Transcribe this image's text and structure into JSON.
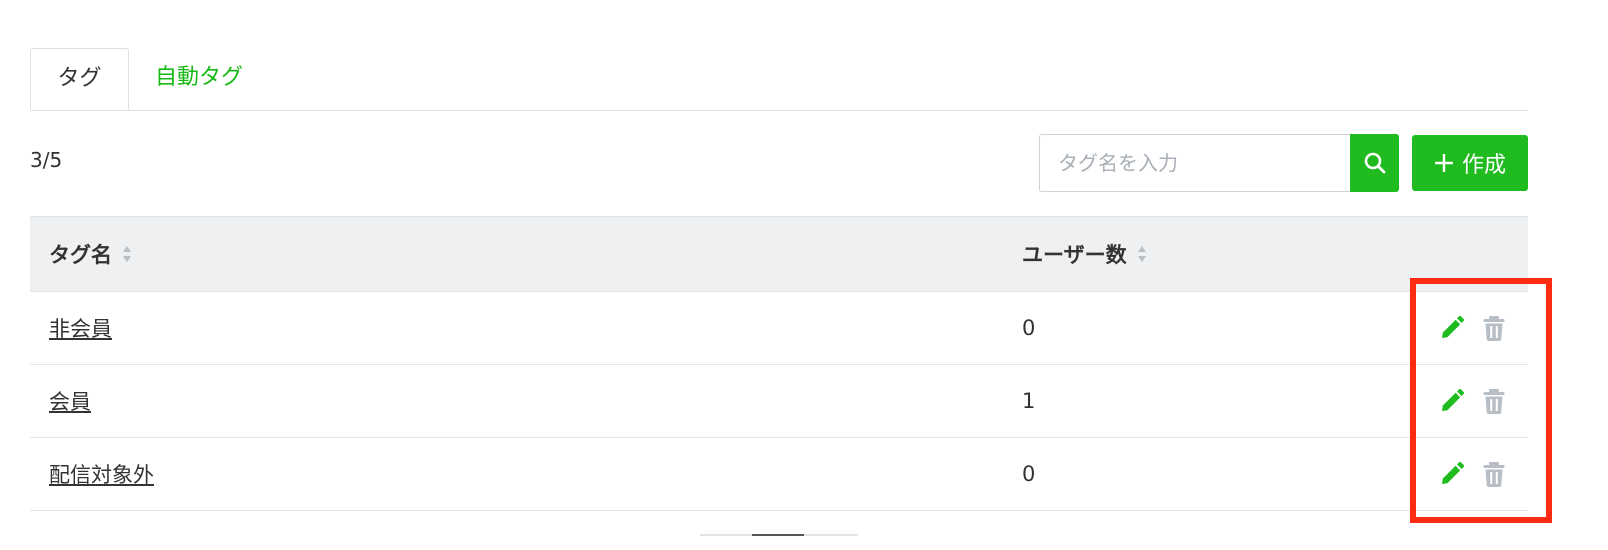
{
  "tabs": [
    {
      "label": "タグ",
      "active": true
    },
    {
      "label": "自動タグ",
      "active": false
    }
  ],
  "count": "3/5",
  "search": {
    "placeholder": "タグ名を入力",
    "icon": "search-icon"
  },
  "create_button": {
    "label": "作成",
    "icon": "plus-icon"
  },
  "table": {
    "headers": [
      "タグ名",
      "ユーザー数"
    ],
    "rows": [
      {
        "name": "非会員",
        "users": "0"
      },
      {
        "name": "会員",
        "users": "1"
      },
      {
        "name": "配信対象外",
        "users": "0"
      }
    ],
    "row_actions": [
      "pencil-icon",
      "trash-icon"
    ]
  },
  "colors": {
    "accent": "#1fbb1f",
    "highlight": "#ff2a12",
    "header_bg": "#eef0f2",
    "muted_icon": "#b8bec5"
  }
}
